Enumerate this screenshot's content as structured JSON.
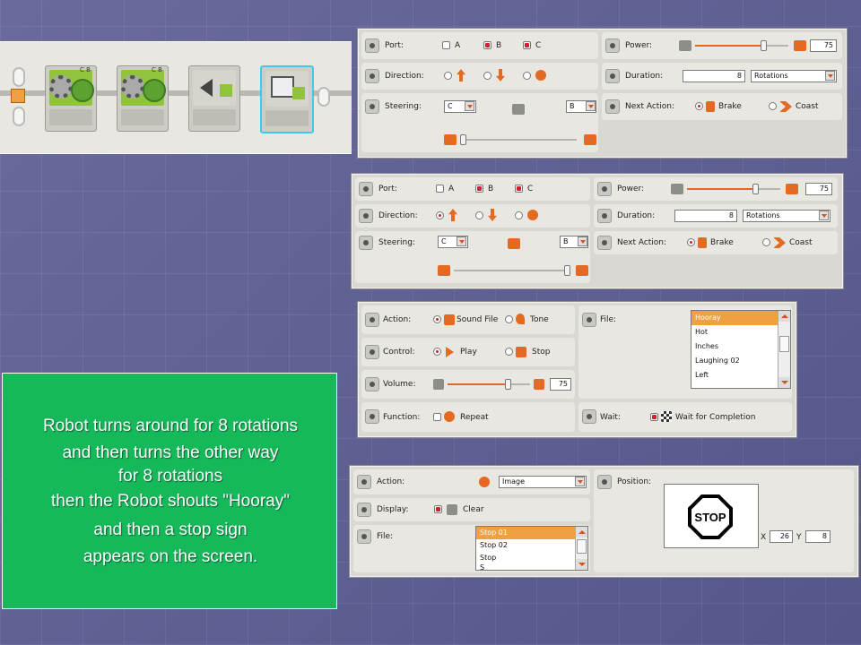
{
  "program_strip": {
    "blocks": [
      {
        "type": "move",
        "ports_label": "C B"
      },
      {
        "type": "move",
        "ports_label": "C B"
      },
      {
        "type": "sound"
      },
      {
        "type": "display"
      }
    ]
  },
  "move_panel_1": {
    "port_label": "Port:",
    "port_options": [
      {
        "label": "A",
        "checked": false
      },
      {
        "label": "B",
        "checked": true
      },
      {
        "label": "C",
        "checked": true
      }
    ],
    "direction_label": "Direction:",
    "direction_options": [
      {
        "name": "forward",
        "selected": false
      },
      {
        "name": "backward",
        "selected": false
      },
      {
        "name": "stop",
        "selected": false
      }
    ],
    "steering_label": "Steering:",
    "steering_left_port": "C",
    "steering_right_port": "B",
    "steering_fraction": 0,
    "power_label": "Power:",
    "power_value": "75",
    "power_fraction": 0.75,
    "duration_label": "Duration:",
    "duration_value": "8",
    "duration_unit": "Rotations",
    "next_action_label": "Next Action:",
    "next_action_options": [
      {
        "label": "Brake",
        "selected": true
      },
      {
        "label": "Coast",
        "selected": false
      }
    ]
  },
  "move_panel_2": {
    "port_label": "Port:",
    "port_options": [
      {
        "label": "A",
        "checked": false
      },
      {
        "label": "B",
        "checked": true
      },
      {
        "label": "C",
        "checked": true
      }
    ],
    "direction_label": "Direction:",
    "steering_label": "Steering:",
    "steering_left_port": "C",
    "steering_right_port": "B",
    "steering_fraction": 1,
    "power_label": "Power:",
    "power_value": "75",
    "power_fraction": 0.75,
    "duration_label": "Duration:",
    "duration_value": "8",
    "duration_unit": "Rotations",
    "next_action_label": "Next Action:",
    "next_action_options": [
      {
        "label": "Brake",
        "selected": true
      },
      {
        "label": "Coast",
        "selected": false
      }
    ]
  },
  "sound_panel": {
    "action_label": "Action:",
    "action_options": [
      {
        "label": "Sound File",
        "selected": true
      },
      {
        "label": "Tone",
        "selected": false
      }
    ],
    "control_label": "Control:",
    "control_options": [
      {
        "label": "Play",
        "selected": true
      },
      {
        "label": "Stop",
        "selected": false
      }
    ],
    "volume_label": "Volume:",
    "volume_value": "75",
    "volume_fraction": 0.75,
    "function_label": "Function:",
    "function_option": "Repeat",
    "file_label": "File:",
    "files": [
      "Hooray",
      "Hot",
      "Inches",
      "Laughing 02",
      "Left"
    ],
    "selected_file": "Hooray",
    "wait_label": "Wait:",
    "wait_option": "Wait for Completion"
  },
  "display_panel": {
    "action_label": "Action:",
    "action_value": "Image",
    "display_label": "Display:",
    "clear_label": "Clear",
    "file_label": "File:",
    "files": [
      "Stop 01",
      "Stop 02",
      "Stop",
      "S"
    ],
    "selected_file": "Stop 01",
    "position_label": "Position:",
    "preview_text": "STOP",
    "x_label": "X",
    "x_value": "26",
    "y_label": "Y",
    "y_value": "8"
  },
  "caption": {
    "lines": [
      "Robot turns around for 8 rotations",
      "and then turns the other way",
      "for 8 rotations",
      "then the Robot shouts \"Hooray\"",
      "and then a stop sign",
      "appears on the screen."
    ]
  },
  "colors": {
    "accent": "#e46a22",
    "block_green": "#8fc43c",
    "caption_bg": "#16b95a",
    "background": "#5f6090"
  }
}
